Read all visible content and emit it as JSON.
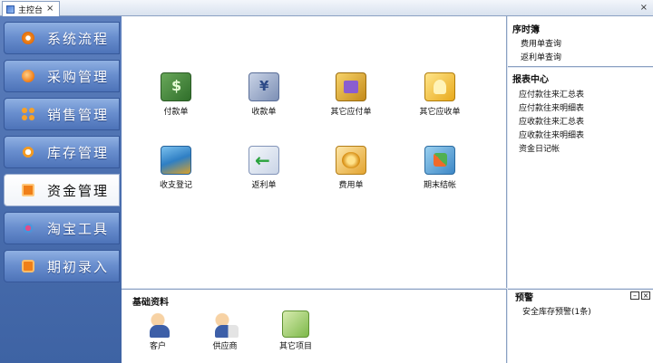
{
  "tabs": [
    {
      "label": "主控台"
    }
  ],
  "sidebar": {
    "items": [
      {
        "label": "系统流程",
        "icon": "flow-icon"
      },
      {
        "label": "采购管理",
        "icon": "purchase-icon"
      },
      {
        "label": "销售管理",
        "icon": "sales-icon"
      },
      {
        "label": "库存管理",
        "icon": "inventory-icon"
      },
      {
        "label": "资金管理",
        "icon": "funds-icon",
        "active": true
      },
      {
        "label": "淘宝工具",
        "icon": "taobao-icon"
      },
      {
        "label": "期初录入",
        "icon": "opening-entry-icon"
      }
    ]
  },
  "main": {
    "tiles": [
      {
        "label": "付款单",
        "icon": "payment-voucher-icon"
      },
      {
        "label": "收款单",
        "icon": "receipt-voucher-icon"
      },
      {
        "label": "其它应付单",
        "icon": "other-payable-icon"
      },
      {
        "label": "其它应收单",
        "icon": "other-receivable-icon"
      },
      {
        "label": "收支登记",
        "icon": "income-expense-ledger-icon"
      },
      {
        "label": "返利单",
        "icon": "rebate-voucher-icon"
      },
      {
        "label": "费用单",
        "icon": "expense-voucher-icon"
      },
      {
        "label": "期末结帐",
        "icon": "period-closing-icon"
      }
    ]
  },
  "basic": {
    "title": "基础资料",
    "items": [
      {
        "label": "客户",
        "icon": "customer-icon"
      },
      {
        "label": "供应商",
        "icon": "supplier-icon"
      },
      {
        "label": "其它项目",
        "icon": "other-items-icon"
      }
    ]
  },
  "sequence": {
    "title": "序时簿",
    "links": [
      "费用单查询",
      "返利单查询"
    ]
  },
  "reports": {
    "title": "报表中心",
    "links": [
      "应付款往来汇总表",
      "应付款往来明细表",
      "应收款往来汇总表",
      "应收款往来明细表",
      "资金日记帐"
    ]
  },
  "warning": {
    "title": "预警",
    "text": "安全库存预警(1条)"
  },
  "colors": {
    "sidebar": "#4a6eae",
    "accent": "#f07f18",
    "panel": "#ffffff",
    "border": "#8aa0c2"
  }
}
